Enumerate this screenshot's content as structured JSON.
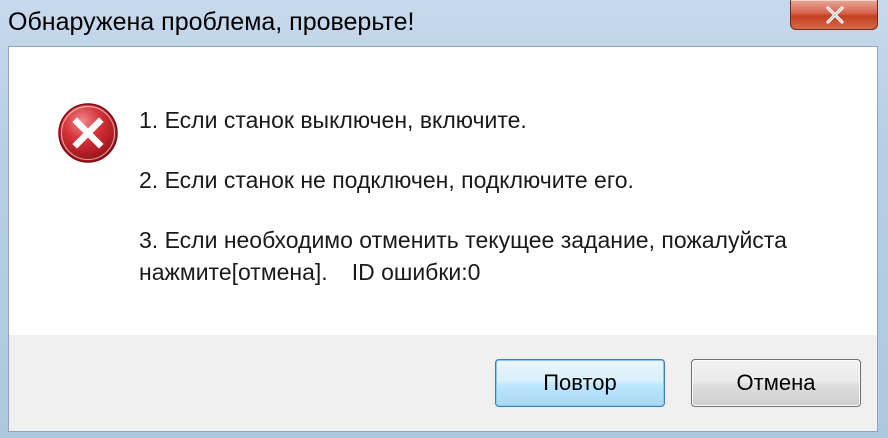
{
  "window": {
    "title": "Обнаружена проблема, проверьте!"
  },
  "icons": {
    "error": "error-x-icon",
    "close": "close-icon"
  },
  "message": {
    "line1": "1. Если станок выключен, включите.",
    "line2": "2. Если станок не подключен, подключите его.",
    "line3": "3. Если необходимо отменить текущее задание, пожалуйста",
    "line4a": "нажмите[отмена].",
    "line4b": "ID ошибки:0"
  },
  "buttons": {
    "retry": "Повтор",
    "cancel": "Отмена"
  },
  "colors": {
    "error_red": "#c8202a",
    "close_red": "#c3401f",
    "focus_blue": "#3c7fb1"
  }
}
